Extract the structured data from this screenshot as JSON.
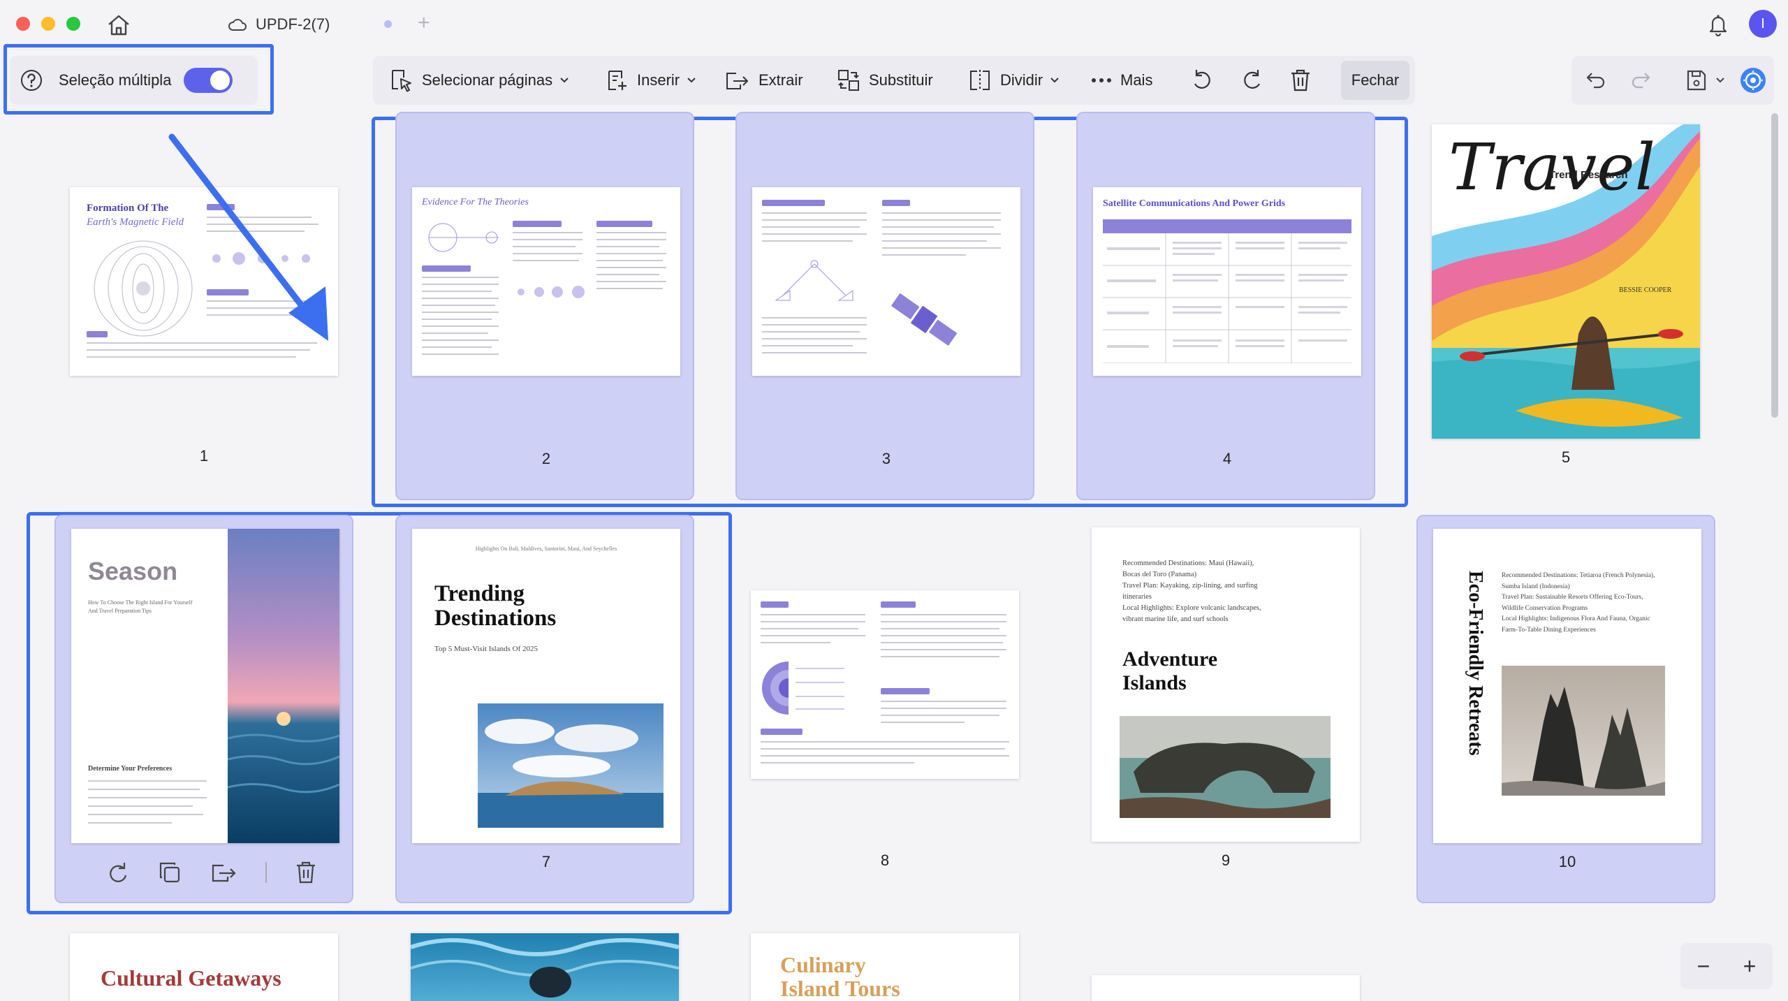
{
  "window": {
    "doc_title": "UPDF-2(7)",
    "new_tab": "+",
    "avatar_letter": "I"
  },
  "multi_select": {
    "label": "Seleção múltipla",
    "enabled": true
  },
  "toolbar": {
    "select_pages": "Selecionar páginas",
    "insert": "Inserir",
    "extract": "Extrair",
    "replace": "Substituir",
    "split": "Dividir",
    "more": "Mais",
    "close": "Fechar"
  },
  "colors": {
    "accent": "#5c63ea",
    "selection_border": "#3c6ff0",
    "selected_card": "#cfd0f5"
  },
  "pages": [
    {
      "number": "1",
      "title": "Formation Of The",
      "subtitle": "Earth's Magnetic Field"
    },
    {
      "number": "2",
      "title": "Evidence For The Theories"
    },
    {
      "number": "3"
    },
    {
      "number": "4",
      "title": "Satellite Communications And Power Grids"
    },
    {
      "number": "5",
      "title": "Travel",
      "subtitle": "Trend Research",
      "author": "BESSIE COOPER"
    },
    {
      "number": "6",
      "title": "Season",
      "subtitle": "How To Choose The Right Island For Yourself And Travel Preparation Tips",
      "section": "Determine Your Preferences"
    },
    {
      "number": "7",
      "header": "Highlights On Bali, Maldives, Santorini, Maui, And Seychelles",
      "title": "Trending Destinations",
      "subtitle": "Top 5 Must-Visit Islands Of 2025"
    },
    {
      "number": "8"
    },
    {
      "number": "9",
      "title": "Adventure Islands",
      "lines": [
        "Recommended Destinations: Maui (Hawaii),",
        "Bocas del Toro (Panama)",
        "Travel Plan: Kayaking, zip-lining, and surfing",
        "itineraries",
        "Local Highlights: Explore volcanic landscapes,",
        "vibrant marine life, and surf schools"
      ]
    },
    {
      "number": "10",
      "title": "Eco-Friendly Retreats",
      "lines": [
        "Recommended Destinations: Tetiaroa (French Polynesia),",
        "Sumba Island (Indonesia)",
        "Travel Plan: Sustainable Resorts Offering Eco-Tours,",
        "Wildlife Conservation Programs",
        "Local Highlights: Indigenous Flora And Fauna, Organic",
        "Farm-To-Table Dining Experiences"
      ]
    },
    {
      "title": "Cultural Getaways"
    },
    {
      "title": "Culinary Island Tours"
    }
  ],
  "zoom": {
    "minus": "−",
    "plus": "+"
  }
}
